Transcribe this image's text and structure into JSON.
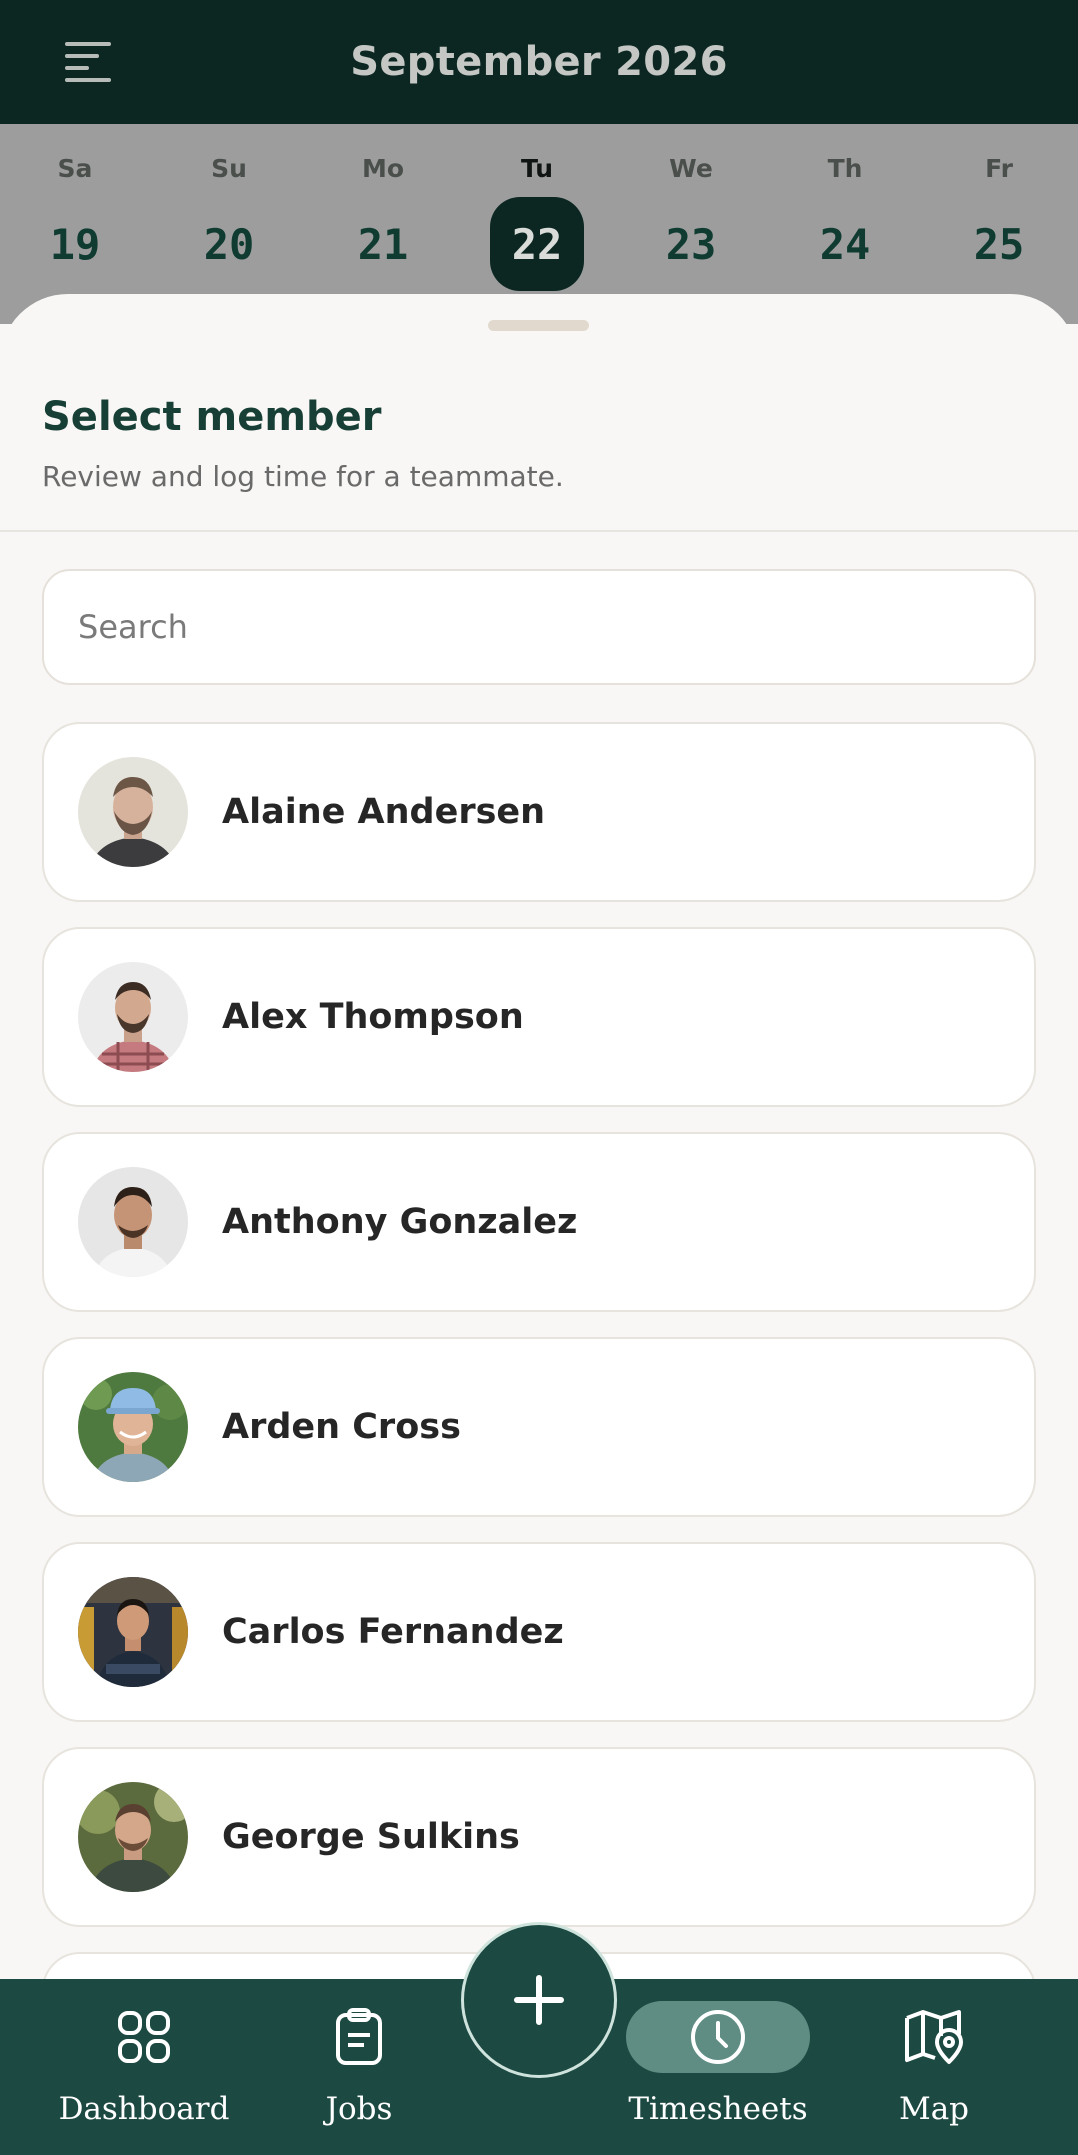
{
  "header": {
    "title": "September 2026",
    "menu_icon": "menu-icon"
  },
  "week": {
    "selected_index": 3,
    "days": [
      {
        "name": "Sa",
        "num": "19"
      },
      {
        "name": "Su",
        "num": "20"
      },
      {
        "name": "Mo",
        "num": "21"
      },
      {
        "name": "Tu",
        "num": "22"
      },
      {
        "name": "We",
        "num": "23"
      },
      {
        "name": "Th",
        "num": "24"
      },
      {
        "name": "Fr",
        "num": "25"
      }
    ]
  },
  "sheet": {
    "title": "Select member",
    "subtitle": "Review and log time for a teammate.",
    "search": {
      "placeholder": "Search",
      "value": ""
    },
    "members": [
      {
        "name": "Alaine Andersen"
      },
      {
        "name": "Alex Thompson"
      },
      {
        "name": "Anthony Gonzalez"
      },
      {
        "name": "Arden Cross"
      },
      {
        "name": "Carlos Fernandez"
      },
      {
        "name": "George Sulkins"
      }
    ]
  },
  "nav": {
    "items": [
      {
        "label": "Dashboard",
        "icon": "grid-icon"
      },
      {
        "label": "Jobs",
        "icon": "clipboard-icon"
      },
      {
        "label": "Timesheets",
        "icon": "clock-icon",
        "active": true
      },
      {
        "label": "Map",
        "icon": "map-pin-icon"
      }
    ],
    "fab_icon": "plus-icon"
  },
  "colors": {
    "brand_dark": "#0c2722",
    "nav_bg": "#1c4a42",
    "active_pill": "#5f8d84",
    "title_green": "#173f35"
  }
}
